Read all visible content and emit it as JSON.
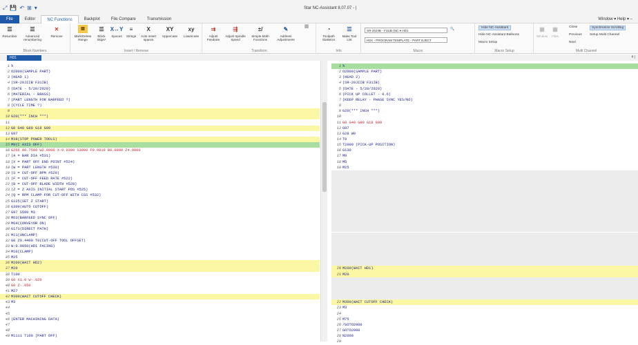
{
  "window": {
    "title": "Star NC-Assistant 8.07.07 - |",
    "window_menu": "Window ▾  Help ▾  –"
  },
  "quick_access": [
    "⤢",
    "💾",
    "↶",
    "⊞",
    "▾"
  ],
  "tabs": [
    "File",
    "Editor",
    "NC Functions",
    "Backplot",
    "File Compare",
    "Transmission"
  ],
  "active_tab": "NC Functions",
  "ribbon": {
    "groups": {
      "block_numbers": "Block Numbers",
      "insert_remove": "Insert / Remove",
      "transform": "Transform",
      "info": "Info",
      "macro": "Macro",
      "macro_setup": "Macro Setup",
      "multi_channel": "Multi Channel"
    },
    "buttons": {
      "resumber": "Resumber",
      "advanced_renumbering": "Advanced renumbering",
      "remove": "Remove",
      "mark_delete_range": "Mark/Delete Range",
      "block_skips": "Block Skips*",
      "spaces": "Spaces",
      "strings": "Strings",
      "auto_insert_spaces": "Auto insert spaces",
      "uppercase": "Uppercase",
      "lowercase": "Lowercase",
      "adjust_feedrate": "Adjust Feedrate",
      "adjust_spindle_speed": "Adjust Spindle Speed",
      "simple_math_functions": "Simple Math Functions",
      "address_adjustments": "Address Adjustments",
      "toolpath_statistics": "Toolpath Statistics",
      "make_tool_list": "Make Tool List"
    },
    "icon_text": {
      "xy1": "X↔Y",
      "x": "X",
      "xy2": "XY",
      "xy3": "xy",
      "math": "±/"
    },
    "machine_select": "SR-20JIIB - F31iB (NC ▾ HD1",
    "program_select": "HD1 - PROGRAM TEMPLATE - PART EJECT",
    "macro_setup_items": {
      "hide_nc_assistant": "Hide NC-Assistant",
      "hide_balloons": "Hide NC-Assistant Balloons",
      "macro_setup": "Macro Setup"
    },
    "window_files": {
      "window": "Window",
      "files": "Files"
    },
    "multi_channel_items": {
      "close": "Close",
      "previous": "Previous",
      "next": "Next",
      "sync_scrolling": "Synchronize Scrolling",
      "setup_multi_channel": "Setup Multi Channel"
    }
  },
  "pane_tab": "HD1",
  "page_indicator": "4 |",
  "left_lines": [
    {
      "n": "1",
      "t": "%",
      "s": ""
    },
    {
      "n": "2",
      "t": "O2000(SAMPLE PART)",
      "s": ""
    },
    {
      "n": "3",
      "t": "(HEAD 1)",
      "s": ""
    },
    {
      "n": "4",
      "t": "(SR-20JIIB F31IB)",
      "s": ""
    },
    {
      "n": "5",
      "t": "(DATE - 5/20/2020)",
      "s": ""
    },
    {
      "n": "6",
      "t": "(MATERIAL - BRASS)",
      "s": ""
    },
    {
      "n": "7",
      "t": "(PART LENGTH FOR BARFEED ?)",
      "s": ""
    },
    {
      "n": "8",
      "t": "(CYCLE TIME ?)",
      "s": ""
    },
    {
      "n": "9",
      "t": "",
      "s": "yellow"
    },
    {
      "n": "10",
      "t": "G20(*** INCH ***)",
      "s": "yellow"
    },
    {
      "n": "11",
      "t": "",
      "s": ""
    },
    {
      "n": "12",
      "t": "G0 G40 G80 G18 G99",
      "s": "yellow"
    },
    {
      "n": "13",
      "t": "G97",
      "s": ""
    },
    {
      "n": "14",
      "t": "M38(STOP POWER TOOLS)",
      "s": "yellow"
    },
    {
      "n": "15",
      "t": "M9(C AXIS OFF)",
      "s": "green"
    },
    {
      "n": "16",
      "t": "G266 A0.7500 W2.0000 X-0.0300 S3000 F0.0010 B0.0800 Z4.9000",
      "s": "red"
    },
    {
      "n": "17",
      "t": "(A = BAR DIA #531)",
      "s": ""
    },
    {
      "n": "18",
      "t": "(X = PART OFF END POINT #524)",
      "s": ""
    },
    {
      "n": "19",
      "t": "(W = PART LENGTH #530)",
      "s": ""
    },
    {
      "n": "20",
      "t": "(S = CUT-OFF RPM #529)",
      "s": ""
    },
    {
      "n": "21",
      "t": "(F = CUT-OFF FEED RATE #522)",
      "s": ""
    },
    {
      "n": "22",
      "t": "(B = CUT-OFF BLADE WIDTH #528)",
      "s": ""
    },
    {
      "n": "23",
      "t": "(Z = Z AXIS INITIAL START POS #525)",
      "s": ""
    },
    {
      "n": "24",
      "t": "(Q = RPM CLAMP FOR CUT-OFF WITH CSS #532)",
      "s": ""
    },
    {
      "n": "25",
      "t": "G125(SET Z START)",
      "s": ""
    },
    {
      "n": "26",
      "t": "G300(AUTO CUTOFF)",
      "s": ""
    },
    {
      "n": "27",
      "t": "G97 S500 M3",
      "s": ""
    },
    {
      "n": "28",
      "t": "M63(BARFEED SYNC OFF)",
      "s": ""
    },
    {
      "n": "29",
      "t": "M64(CONVEYOR ON)",
      "s": ""
    },
    {
      "n": "30",
      "t": "G171(DIRECT PATH)",
      "s": ""
    },
    {
      "n": "31",
      "t": "M11(UNCLAMP)",
      "s": ""
    },
    {
      "n": "32",
      "t": "G0 Z0.4400 T0(CUT-OFF TOOL OFFSET)",
      "s": ""
    },
    {
      "n": "33",
      "t": "W-0.0050(HD1 FACING)",
      "s": ""
    },
    {
      "n": "34",
      "t": "M10(CLAMP)",
      "s": ""
    },
    {
      "n": "35",
      "t": "M25",
      "s": ""
    },
    {
      "n": "36",
      "t": "M200(WAIT HD2)",
      "s": "yellow"
    },
    {
      "n": "37",
      "t": "M20",
      "s": "yellow"
    },
    {
      "n": "38",
      "t": "T100",
      "s": ""
    },
    {
      "n": "39",
      "t": "G0 X1.0 W-.020",
      "s": "red"
    },
    {
      "n": "40",
      "t": "G0 Z-.050",
      "s": "red"
    },
    {
      "n": "41",
      "t": "M27",
      "s": ""
    },
    {
      "n": "42",
      "t": "M300(WAIT CUTOFF CHECK)",
      "s": "yellow"
    },
    {
      "n": "43",
      "t": "M3",
      "s": ""
    },
    {
      "n": "44",
      "t": "",
      "s": ""
    },
    {
      "n": "45",
      "t": "",
      "s": ""
    },
    {
      "n": "46",
      "t": "(ENTER MACHINING DATA)",
      "s": ""
    },
    {
      "n": "47",
      "t": "",
      "s": ""
    },
    {
      "n": "48",
      "t": "",
      "s": ""
    },
    {
      "n": "49",
      "t": "M1111 T100 (PART OFF)",
      "s": ""
    }
  ],
  "right_lines": [
    {
      "n": "1",
      "t": "%",
      "s": "green"
    },
    {
      "n": "2",
      "t": "O2000(SAMPLE PART)",
      "s": ""
    },
    {
      "n": "3",
      "t": "(HEAD 2)",
      "s": ""
    },
    {
      "n": "4",
      "t": "(SR-20JIIB F31IB)",
      "s": ""
    },
    {
      "n": "5",
      "t": "(DATE - 5/20/2020)",
      "s": ""
    },
    {
      "n": "6",
      "t": "(PICK UP COLLET - 0.6)",
      "s": ""
    },
    {
      "n": "7",
      "t": "(KEEP RELAY - PHASE SYNC YES/NO)",
      "s": ""
    },
    {
      "n": "8",
      "t": "",
      "s": ""
    },
    {
      "n": "9",
      "t": "G20(*** INCH ***)",
      "s": ""
    },
    {
      "n": "10",
      "t": "",
      "s": ""
    },
    {
      "n": "11",
      "t": "G0 G40 G80 G18 G99",
      "s": "red"
    },
    {
      "n": "12",
      "t": "G97",
      "s": ""
    },
    {
      "n": "13",
      "t": "G28 W0",
      "s": ""
    },
    {
      "n": "14",
      "t": "T0",
      "s": ""
    },
    {
      "n": "15",
      "t": "T2000 (PICK-UP POSITION)",
      "s": ""
    },
    {
      "n": "16",
      "t": "G130",
      "s": ""
    },
    {
      "n": "17",
      "t": "M9",
      "s": ""
    },
    {
      "n": "18",
      "t": "M5",
      "s": ""
    },
    {
      "n": "19",
      "t": "M25",
      "s": ""
    },
    {
      "n": "",
      "t": "",
      "s": "grey"
    },
    {
      "n": "",
      "t": "",
      "s": "grey"
    },
    {
      "n": "",
      "t": "",
      "s": "grey"
    },
    {
      "n": "",
      "t": "",
      "s": "grey"
    },
    {
      "n": "",
      "t": "",
      "s": "grey"
    },
    {
      "n": "",
      "t": "",
      "s": "grey"
    },
    {
      "n": "",
      "t": "",
      "s": "grey"
    },
    {
      "n": "",
      "t": "",
      "s": "grey"
    },
    {
      "n": "",
      "t": "",
      "s": "grey"
    },
    {
      "n": "",
      "t": "",
      "s": "grey"
    },
    {
      "n": "",
      "t": "",
      "s": "grey"
    },
    {
      "n": "",
      "t": "",
      "s": "grey"
    },
    {
      "n": "",
      "t": "",
      "s": "grey"
    },
    {
      "n": "",
      "t": "",
      "s": "grey"
    },
    {
      "n": "",
      "t": "",
      "s": "grey"
    },
    {
      "n": "",
      "t": "",
      "s": "grey"
    },
    {
      "n": "",
      "t": "",
      "s": "grey"
    },
    {
      "n": "20",
      "t": "M200(WAIT HD1)",
      "s": "yellow"
    },
    {
      "n": "21",
      "t": "M20",
      "s": "yellow"
    },
    {
      "n": "",
      "t": "",
      "s": "grey"
    },
    {
      "n": "",
      "t": "",
      "s": "grey"
    },
    {
      "n": "",
      "t": "",
      "s": "grey"
    },
    {
      "n": "",
      "t": "",
      "s": "grey"
    },
    {
      "n": "22",
      "t": "M300(WAIT CUTOFF CHECK)",
      "s": "yellow"
    },
    {
      "n": "23",
      "t": "M3",
      "s": ""
    },
    {
      "n": "24",
      "t": "",
      "s": ""
    },
    {
      "n": "25",
      "t": "M75",
      "s": ""
    },
    {
      "n": "26",
      "t": "/GOTO2000",
      "s": ""
    },
    {
      "n": "27",
      "t": "GOTO2900",
      "s": ""
    },
    {
      "n": "28",
      "t": "N2000",
      "s": ""
    },
    {
      "n": "29",
      "t": "",
      "s": ""
    }
  ],
  "colors": {
    "accent": "#1e5aa8",
    "highlight_yellow": "#fbf7a3",
    "highlight_green": "#a8dfa0",
    "code_text": "#1a1a8c",
    "red_text": "#c0282f"
  }
}
